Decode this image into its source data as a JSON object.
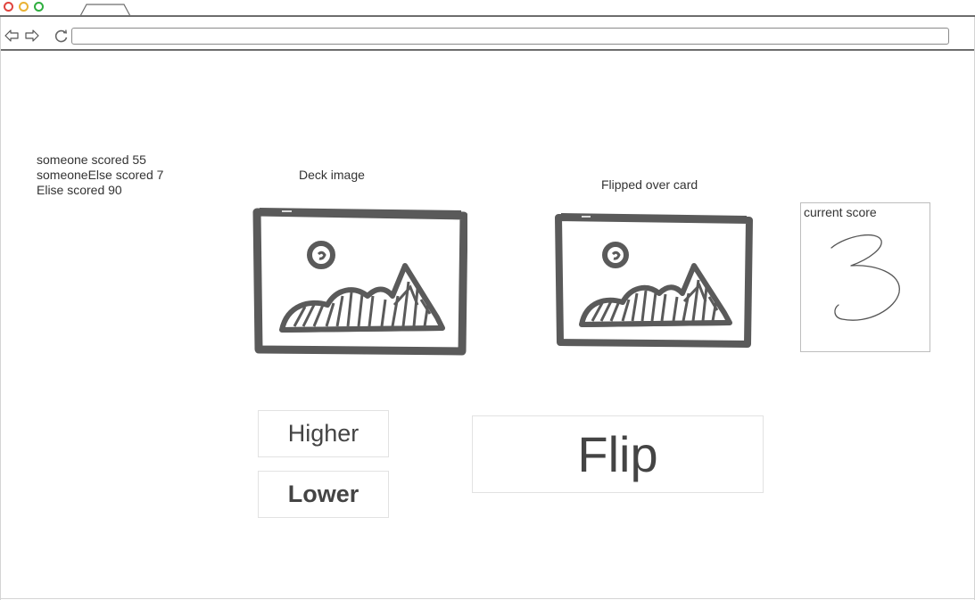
{
  "browser": {
    "url": "",
    "icons": {
      "close": "close-dot",
      "minimize": "minimize-dot",
      "maximize": "maximize-dot",
      "back": "back-arrow-icon",
      "forward": "forward-arrow-icon",
      "reload": "reload-icon"
    },
    "colors": {
      "close": "#e0443e",
      "minimize": "#e9b234",
      "maximize": "#2fae3f"
    }
  },
  "leaderboard": {
    "entries": [
      "someone scored 55",
      "someoneElse scored 7",
      "Elise scored 90"
    ]
  },
  "deck": {
    "label": "Deck image",
    "image_icon": "image-placeholder-icon"
  },
  "flipped": {
    "label": "Flipped over card",
    "image_icon": "image-placeholder-icon"
  },
  "score": {
    "label": "current score",
    "value": "3"
  },
  "buttons": {
    "higher": "Higher",
    "lower": "Lower",
    "flip": "Flip"
  }
}
